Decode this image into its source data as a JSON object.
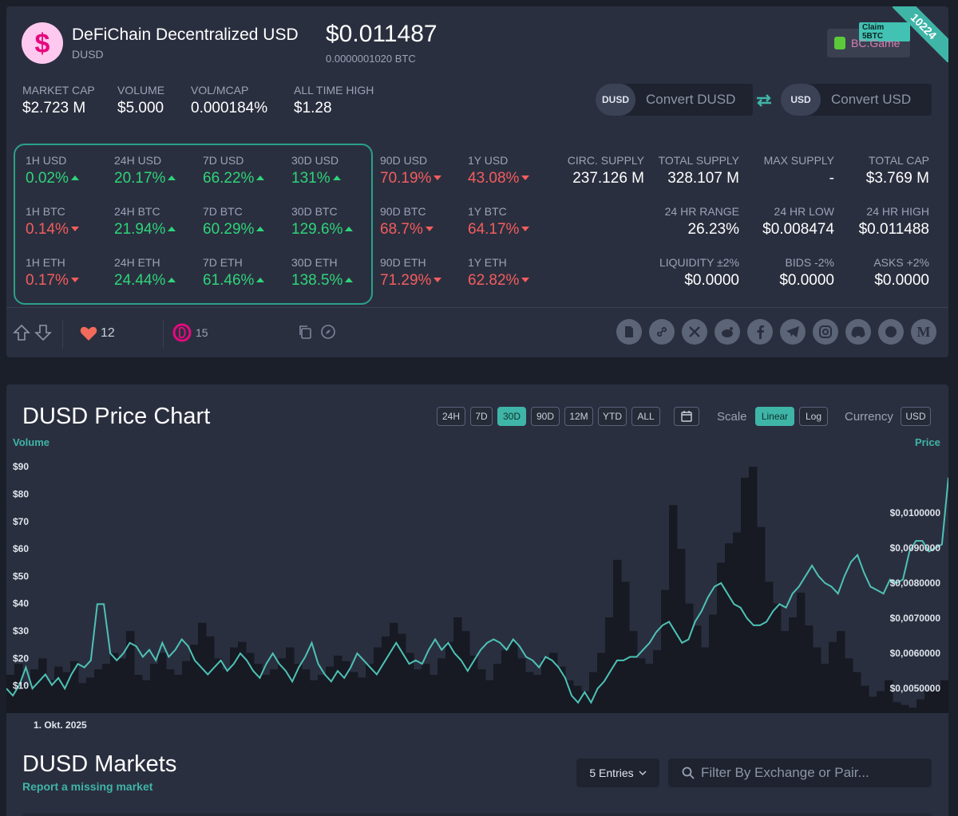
{
  "coin": {
    "name": "DeFiChain Decentralized USD",
    "symbol": "DUSD",
    "price": "$0.011487",
    "price_btc": "0.0000001020 BTC",
    "rank": "10224"
  },
  "ad": {
    "claim": "Claim 5BTC",
    "brand": "BC.Game"
  },
  "stats": [
    {
      "label": "MARKET CAP",
      "value": "$2.723 M"
    },
    {
      "label": "VOLUME",
      "value": "$5.000"
    },
    {
      "label": "VOL/MCAP",
      "value": "0.000184%"
    },
    {
      "label": "ALL TIME HIGH",
      "value": "$1.28"
    }
  ],
  "convert": {
    "from_tag": "DUSD",
    "from_placeholder": "Convert DUSD",
    "to_tag": "USD",
    "to_placeholder": "Convert USD"
  },
  "changes": [
    [
      {
        "label": "1H USD",
        "value": "0.02%",
        "dir": "up"
      },
      {
        "label": "24H USD",
        "value": "20.17%",
        "dir": "up"
      },
      {
        "label": "7D USD",
        "value": "66.22%",
        "dir": "up"
      },
      {
        "label": "30D USD",
        "value": "131%",
        "dir": "up"
      },
      {
        "label": "90D USD",
        "value": "70.19%",
        "dir": "down"
      },
      {
        "label": "1Y USD",
        "value": "43.08%",
        "dir": "down"
      }
    ],
    [
      {
        "label": "1H BTC",
        "value": "0.14%",
        "dir": "down"
      },
      {
        "label": "24H BTC",
        "value": "21.94%",
        "dir": "up"
      },
      {
        "label": "7D BTC",
        "value": "60.29%",
        "dir": "up"
      },
      {
        "label": "30D BTC",
        "value": "129.6%",
        "dir": "up"
      },
      {
        "label": "90D BTC",
        "value": "68.7%",
        "dir": "down"
      },
      {
        "label": "1Y BTC",
        "value": "64.17%",
        "dir": "down"
      }
    ],
    [
      {
        "label": "1H ETH",
        "value": "0.17%",
        "dir": "down"
      },
      {
        "label": "24H ETH",
        "value": "24.44%",
        "dir": "up"
      },
      {
        "label": "7D ETH",
        "value": "61.46%",
        "dir": "up"
      },
      {
        "label": "30D ETH",
        "value": "138.5%",
        "dir": "up"
      },
      {
        "label": "90D ETH",
        "value": "71.29%",
        "dir": "down"
      },
      {
        "label": "1Y ETH",
        "value": "62.82%",
        "dir": "down"
      }
    ]
  ],
  "supply": [
    [
      {
        "label": "CIRC. SUPPLY",
        "value": "237.126 M"
      },
      {
        "label": "TOTAL SUPPLY",
        "value": "328.107 M"
      },
      {
        "label": "MAX SUPPLY",
        "value": "-"
      },
      {
        "label": "TOTAL CAP",
        "value": "$3.769 M"
      }
    ],
    [
      {
        "label": "",
        "value": ""
      },
      {
        "label": "24 HR RANGE",
        "value": "26.23%"
      },
      {
        "label": "24 HR LOW",
        "value": "$0.008474"
      },
      {
        "label": "24 HR HIGH",
        "value": "$0.011488"
      }
    ],
    [
      {
        "label": "",
        "value": ""
      },
      {
        "label": "LIQUIDITY ±2%",
        "value": "$0.0000"
      },
      {
        "label": "BIDS -2%",
        "value": "$0.0000"
      },
      {
        "label": "ASKS +2%",
        "value": "$0.0000"
      }
    ]
  ],
  "social": {
    "likes": "12",
    "community": "15",
    "links": [
      "M"
    ]
  },
  "colors": {
    "accent": "#3fb5a8",
    "up": "#2ed47a",
    "down": "#f35d5d"
  },
  "chart": {
    "title": "DUSD Price Chart",
    "ranges": [
      "24H",
      "7D",
      "30D",
      "90D",
      "12M",
      "YTD",
      "ALL"
    ],
    "active_range": "30D",
    "scale_label": "Scale",
    "scales": [
      "Linear",
      "Log"
    ],
    "active_scale": "Linear",
    "currency_label": "Currency",
    "currency": "USD",
    "left_axis_title": "Volume",
    "right_axis_title": "Price",
    "x_label": "1. Okt. 2025"
  },
  "chart_data": {
    "type": "line",
    "volume_axis": {
      "ticks": [
        "$90",
        "$80",
        "$70",
        "$60",
        "$50",
        "$40",
        "$30",
        "$20",
        "$10"
      ],
      "ylim": [
        0,
        95
      ]
    },
    "price_axis": {
      "ticks": [
        "$0,0100000",
        "$0,0090000",
        "$0,0080000",
        "$0,0070000",
        "$0,0060000",
        "$0,0050000"
      ],
      "ylim": [
        0.0043,
        0.0117
      ]
    },
    "x": [
      "1. Okt. 2025"
    ],
    "series": [
      {
        "values": [
          0.005,
          0.0048,
          0.0051,
          0.0056,
          0.005,
          0.0052,
          0.0054,
          0.0051,
          0.0053,
          0.005,
          0.0054,
          0.0057,
          0.0056,
          0.0058,
          0.0074,
          0.0074,
          0.006,
          0.0058,
          0.006,
          0.0063,
          0.0062,
          0.0059,
          0.0061,
          0.0058,
          0.0063,
          0.0059,
          0.0061,
          0.0064,
          0.0062,
          0.0058,
          0.0056,
          0.0054,
          0.0056,
          0.0058,
          0.0055,
          0.0057,
          0.006,
          0.0058,
          0.0055,
          0.0053,
          0.0057,
          0.006,
          0.0057,
          0.0055,
          0.0052,
          0.0056,
          0.0059,
          0.0063,
          0.0057,
          0.0054,
          0.0052,
          0.0055,
          0.0053,
          0.0056,
          0.006,
          0.0058,
          0.0056,
          0.0054,
          0.0057,
          0.006,
          0.0063,
          0.006,
          0.0057,
          0.0058,
          0.0057,
          0.0061,
          0.0064,
          0.0061,
          0.0063,
          0.006,
          0.0058,
          0.0055,
          0.0058,
          0.0061,
          0.0063,
          0.0064,
          0.0063,
          0.0061,
          0.0064,
          0.0062,
          0.0059,
          0.0058,
          0.0056,
          0.0059,
          0.0058,
          0.0056,
          0.0053,
          0.0048,
          0.0046,
          0.0049,
          0.0046,
          0.005,
          0.0052,
          0.0055,
          0.0058,
          0.0058,
          0.0059,
          0.0059,
          0.0061,
          0.0063,
          0.0066,
          0.0068,
          0.0069,
          0.0066,
          0.0063,
          0.0064,
          0.0069,
          0.0072,
          0.0076,
          0.0079,
          0.008,
          0.0077,
          0.0074,
          0.0073,
          0.007,
          0.0068,
          0.0068,
          0.0069,
          0.0072,
          0.0074,
          0.0073,
          0.0077,
          0.0079,
          0.0082,
          0.0085,
          0.0082,
          0.008,
          0.0079,
          0.0077,
          0.0082,
          0.0086,
          0.0088,
          0.0083,
          0.0079,
          0.0078,
          0.0077,
          0.0081,
          0.008,
          0.0081,
          0.0089,
          0.0092,
          0.0092,
          0.0089,
          0.009,
          0.0091,
          0.011
        ]
      },
      {
        "values": [
          14,
          18,
          10,
          16,
          20,
          12,
          17,
          15,
          19,
          11,
          13,
          16,
          18,
          22,
          20,
          30,
          14,
          12,
          18,
          22,
          16,
          14,
          19,
          25,
          33,
          28,
          20,
          16,
          24,
          26,
          22,
          18,
          14,
          16,
          20,
          24,
          18,
          16,
          12,
          14,
          17,
          21,
          19,
          15,
          13,
          18,
          24,
          28,
          33,
          29,
          22,
          16,
          18,
          14,
          20,
          26,
          35,
          30,
          21,
          16,
          12,
          18,
          23,
          26,
          20,
          15,
          14,
          20,
          22,
          17,
          12,
          10,
          8,
          15,
          22,
          35,
          56,
          48,
          30,
          20,
          18,
          23,
          45,
          76,
          60,
          40,
          32,
          24,
          36,
          55,
          62,
          66,
          86,
          90,
          68,
          48,
          40,
          30,
          35,
          44,
          32,
          24,
          18,
          26,
          30,
          20,
          15,
          10,
          6,
          8,
          12,
          4,
          3,
          2,
          5,
          8,
          10,
          12
        ]
      }
    ]
  },
  "markets": {
    "title": "DUSD Markets",
    "report_link": "Report a missing market",
    "entries": "5 Entries",
    "filter_placeholder": "Filter By Exchange or Pair..."
  }
}
